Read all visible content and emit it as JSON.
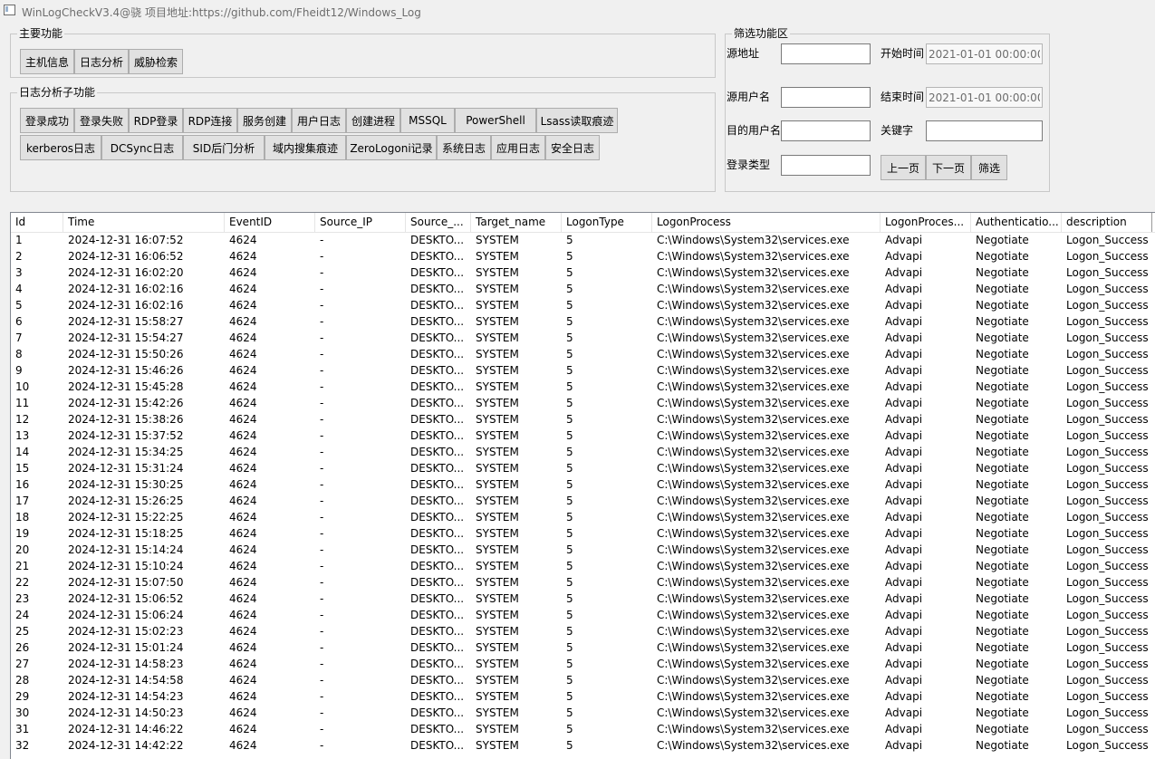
{
  "window": {
    "title": "WinLogCheckV3.4@骁 项目地址:https://github.com/Fheidt12/Windows_Log"
  },
  "main_functions": {
    "legend": "主要功能",
    "buttons": [
      "主机信息",
      "日志分析",
      "威胁检索"
    ]
  },
  "sub_functions": {
    "legend": "日志分析子功能",
    "row1": [
      "登录成功",
      "登录失败",
      "RDP登录",
      "RDP连接",
      "服务创建",
      "用户日志",
      "创建进程",
      "MSSQL",
      "PowerShell",
      "Lsass读取痕迹"
    ],
    "row2": [
      "kerberos日志",
      "DCSync日志",
      "SID后门分析",
      "域内搜集痕迹",
      "ZeroLogoni记录",
      "系统日志",
      "应用日志",
      "安全日志"
    ]
  },
  "filter": {
    "legend": "筛选功能区",
    "source_addr_label": "源地址",
    "source_addr_value": "",
    "source_user_label": "源用户名",
    "source_user_value": "",
    "target_user_label": "目的用户名",
    "target_user_value": "",
    "logon_type_label": "登录类型",
    "logon_type_value": "",
    "start_time_label": "开始时间",
    "start_time_value": "2021-01-01 00:00:00",
    "end_time_label": "结束时间",
    "end_time_value": "2021-01-01 00:00:00",
    "keyword_label": "关键字",
    "keyword_value": "",
    "prev_button": "上一页",
    "next_button": "下一页",
    "filter_button": "筛选"
  },
  "table": {
    "columns": [
      "Id",
      "Time",
      "EventID",
      "Source_IP",
      "Source_...",
      "Target_name",
      "LogonType",
      "LogonProcess",
      "LogonProces...",
      "Authenticatio...",
      "description"
    ],
    "rows": [
      [
        "1",
        "2024-12-31 16:07:52",
        "4624",
        "-",
        "DESKTO...",
        "SYSTEM",
        "5",
        "C:\\Windows\\System32\\services.exe",
        "Advapi",
        "Negotiate",
        "Logon_Success"
      ],
      [
        "2",
        "2024-12-31 16:06:52",
        "4624",
        "-",
        "DESKTO...",
        "SYSTEM",
        "5",
        "C:\\Windows\\System32\\services.exe",
        "Advapi",
        "Negotiate",
        "Logon_Success"
      ],
      [
        "3",
        "2024-12-31 16:02:20",
        "4624",
        "-",
        "DESKTO...",
        "SYSTEM",
        "5",
        "C:\\Windows\\System32\\services.exe",
        "Advapi",
        "Negotiate",
        "Logon_Success"
      ],
      [
        "4",
        "2024-12-31 16:02:16",
        "4624",
        "-",
        "DESKTO...",
        "SYSTEM",
        "5",
        "C:\\Windows\\System32\\services.exe",
        "Advapi",
        "Negotiate",
        "Logon_Success"
      ],
      [
        "5",
        "2024-12-31 16:02:16",
        "4624",
        "-",
        "DESKTO...",
        "SYSTEM",
        "5",
        "C:\\Windows\\System32\\services.exe",
        "Advapi",
        "Negotiate",
        "Logon_Success"
      ],
      [
        "6",
        "2024-12-31 15:58:27",
        "4624",
        "-",
        "DESKTO...",
        "SYSTEM",
        "5",
        "C:\\Windows\\System32\\services.exe",
        "Advapi",
        "Negotiate",
        "Logon_Success"
      ],
      [
        "7",
        "2024-12-31 15:54:27",
        "4624",
        "-",
        "DESKTO...",
        "SYSTEM",
        "5",
        "C:\\Windows\\System32\\services.exe",
        "Advapi",
        "Negotiate",
        "Logon_Success"
      ],
      [
        "8",
        "2024-12-31 15:50:26",
        "4624",
        "-",
        "DESKTO...",
        "SYSTEM",
        "5",
        "C:\\Windows\\System32\\services.exe",
        "Advapi",
        "Negotiate",
        "Logon_Success"
      ],
      [
        "9",
        "2024-12-31 15:46:26",
        "4624",
        "-",
        "DESKTO...",
        "SYSTEM",
        "5",
        "C:\\Windows\\System32\\services.exe",
        "Advapi",
        "Negotiate",
        "Logon_Success"
      ],
      [
        "10",
        "2024-12-31 15:45:28",
        "4624",
        "-",
        "DESKTO...",
        "SYSTEM",
        "5",
        "C:\\Windows\\System32\\services.exe",
        "Advapi",
        "Negotiate",
        "Logon_Success"
      ],
      [
        "11",
        "2024-12-31 15:42:26",
        "4624",
        "-",
        "DESKTO...",
        "SYSTEM",
        "5",
        "C:\\Windows\\System32\\services.exe",
        "Advapi",
        "Negotiate",
        "Logon_Success"
      ],
      [
        "12",
        "2024-12-31 15:38:26",
        "4624",
        "-",
        "DESKTO...",
        "SYSTEM",
        "5",
        "C:\\Windows\\System32\\services.exe",
        "Advapi",
        "Negotiate",
        "Logon_Success"
      ],
      [
        "13",
        "2024-12-31 15:37:52",
        "4624",
        "-",
        "DESKTO...",
        "SYSTEM",
        "5",
        "C:\\Windows\\System32\\services.exe",
        "Advapi",
        "Negotiate",
        "Logon_Success"
      ],
      [
        "14",
        "2024-12-31 15:34:25",
        "4624",
        "-",
        "DESKTO...",
        "SYSTEM",
        "5",
        "C:\\Windows\\System32\\services.exe",
        "Advapi",
        "Negotiate",
        "Logon_Success"
      ],
      [
        "15",
        "2024-12-31 15:31:24",
        "4624",
        "-",
        "DESKTO...",
        "SYSTEM",
        "5",
        "C:\\Windows\\System32\\services.exe",
        "Advapi",
        "Negotiate",
        "Logon_Success"
      ],
      [
        "16",
        "2024-12-31 15:30:25",
        "4624",
        "-",
        "DESKTO...",
        "SYSTEM",
        "5",
        "C:\\Windows\\System32\\services.exe",
        "Advapi",
        "Negotiate",
        "Logon_Success"
      ],
      [
        "17",
        "2024-12-31 15:26:25",
        "4624",
        "-",
        "DESKTO...",
        "SYSTEM",
        "5",
        "C:\\Windows\\System32\\services.exe",
        "Advapi",
        "Negotiate",
        "Logon_Success"
      ],
      [
        "18",
        "2024-12-31 15:22:25",
        "4624",
        "-",
        "DESKTO...",
        "SYSTEM",
        "5",
        "C:\\Windows\\System32\\services.exe",
        "Advapi",
        "Negotiate",
        "Logon_Success"
      ],
      [
        "19",
        "2024-12-31 15:18:25",
        "4624",
        "-",
        "DESKTO...",
        "SYSTEM",
        "5",
        "C:\\Windows\\System32\\services.exe",
        "Advapi",
        "Negotiate",
        "Logon_Success"
      ],
      [
        "20",
        "2024-12-31 15:14:24",
        "4624",
        "-",
        "DESKTO...",
        "SYSTEM",
        "5",
        "C:\\Windows\\System32\\services.exe",
        "Advapi",
        "Negotiate",
        "Logon_Success"
      ],
      [
        "21",
        "2024-12-31 15:10:24",
        "4624",
        "-",
        "DESKTO...",
        "SYSTEM",
        "5",
        "C:\\Windows\\System32\\services.exe",
        "Advapi",
        "Negotiate",
        "Logon_Success"
      ],
      [
        "22",
        "2024-12-31 15:07:50",
        "4624",
        "-",
        "DESKTO...",
        "SYSTEM",
        "5",
        "C:\\Windows\\System32\\services.exe",
        "Advapi",
        "Negotiate",
        "Logon_Success"
      ],
      [
        "23",
        "2024-12-31 15:06:52",
        "4624",
        "-",
        "DESKTO...",
        "SYSTEM",
        "5",
        "C:\\Windows\\System32\\services.exe",
        "Advapi",
        "Negotiate",
        "Logon_Success"
      ],
      [
        "24",
        "2024-12-31 15:06:24",
        "4624",
        "-",
        "DESKTO...",
        "SYSTEM",
        "5",
        "C:\\Windows\\System32\\services.exe",
        "Advapi",
        "Negotiate",
        "Logon_Success"
      ],
      [
        "25",
        "2024-12-31 15:02:23",
        "4624",
        "-",
        "DESKTO...",
        "SYSTEM",
        "5",
        "C:\\Windows\\System32\\services.exe",
        "Advapi",
        "Negotiate",
        "Logon_Success"
      ],
      [
        "26",
        "2024-12-31 15:01:24",
        "4624",
        "-",
        "DESKTO...",
        "SYSTEM",
        "5",
        "C:\\Windows\\System32\\services.exe",
        "Advapi",
        "Negotiate",
        "Logon_Success"
      ],
      [
        "27",
        "2024-12-31 14:58:23",
        "4624",
        "-",
        "DESKTO...",
        "SYSTEM",
        "5",
        "C:\\Windows\\System32\\services.exe",
        "Advapi",
        "Negotiate",
        "Logon_Success"
      ],
      [
        "28",
        "2024-12-31 14:54:58",
        "4624",
        "-",
        "DESKTO...",
        "SYSTEM",
        "5",
        "C:\\Windows\\System32\\services.exe",
        "Advapi",
        "Negotiate",
        "Logon_Success"
      ],
      [
        "29",
        "2024-12-31 14:54:23",
        "4624",
        "-",
        "DESKTO...",
        "SYSTEM",
        "5",
        "C:\\Windows\\System32\\services.exe",
        "Advapi",
        "Negotiate",
        "Logon_Success"
      ],
      [
        "30",
        "2024-12-31 14:50:23",
        "4624",
        "-",
        "DESKTO...",
        "SYSTEM",
        "5",
        "C:\\Windows\\System32\\services.exe",
        "Advapi",
        "Negotiate",
        "Logon_Success"
      ],
      [
        "31",
        "2024-12-31 14:46:22",
        "4624",
        "-",
        "DESKTO...",
        "SYSTEM",
        "5",
        "C:\\Windows\\System32\\services.exe",
        "Advapi",
        "Negotiate",
        "Logon_Success"
      ],
      [
        "32",
        "2024-12-31 14:42:22",
        "4624",
        "-",
        "DESKTO...",
        "SYSTEM",
        "5",
        "C:\\Windows\\System32\\services.exe",
        "Advapi",
        "Negotiate",
        "Logon_Success"
      ]
    ]
  }
}
